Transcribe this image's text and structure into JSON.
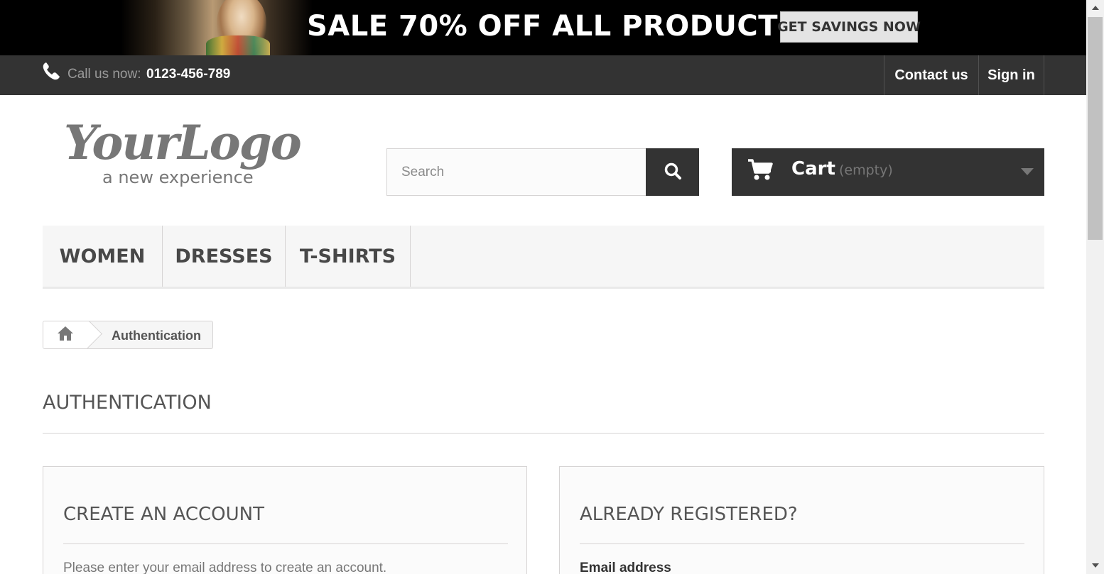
{
  "banner": {
    "headline": "SALE 70% OFF ALL PRODUCTS",
    "cta_label": "GET SAVINGS NOW"
  },
  "topnav": {
    "call_label": "Call us now:",
    "phone_number": "0123-456-789",
    "contact_label": "Contact us",
    "signin_label": "Sign in",
    "phone_icon": "phone-icon"
  },
  "logo": {
    "main": "YourLogo",
    "tagline": "a new experience"
  },
  "search": {
    "placeholder": "Search",
    "value": "",
    "button_icon": "search-icon"
  },
  "cart": {
    "label": "Cart",
    "status": "(empty)",
    "icon": "cart-icon"
  },
  "menu": {
    "items": [
      {
        "label": "WOMEN"
      },
      {
        "label": "DRESSES"
      },
      {
        "label": "T-SHIRTS"
      }
    ]
  },
  "breadcrumb": {
    "home_icon": "home-icon",
    "current": "Authentication"
  },
  "page": {
    "title": "AUTHENTICATION"
  },
  "create_account": {
    "title": "CREATE AN ACCOUNT",
    "instruction": "Please enter your email address to create an account."
  },
  "login": {
    "title": "ALREADY REGISTERED?",
    "email_label": "Email address"
  },
  "colors": {
    "topbar": "#333333",
    "banner": "#000000",
    "menu_bg": "#f6f6f6",
    "border": "#d6d4d4"
  }
}
